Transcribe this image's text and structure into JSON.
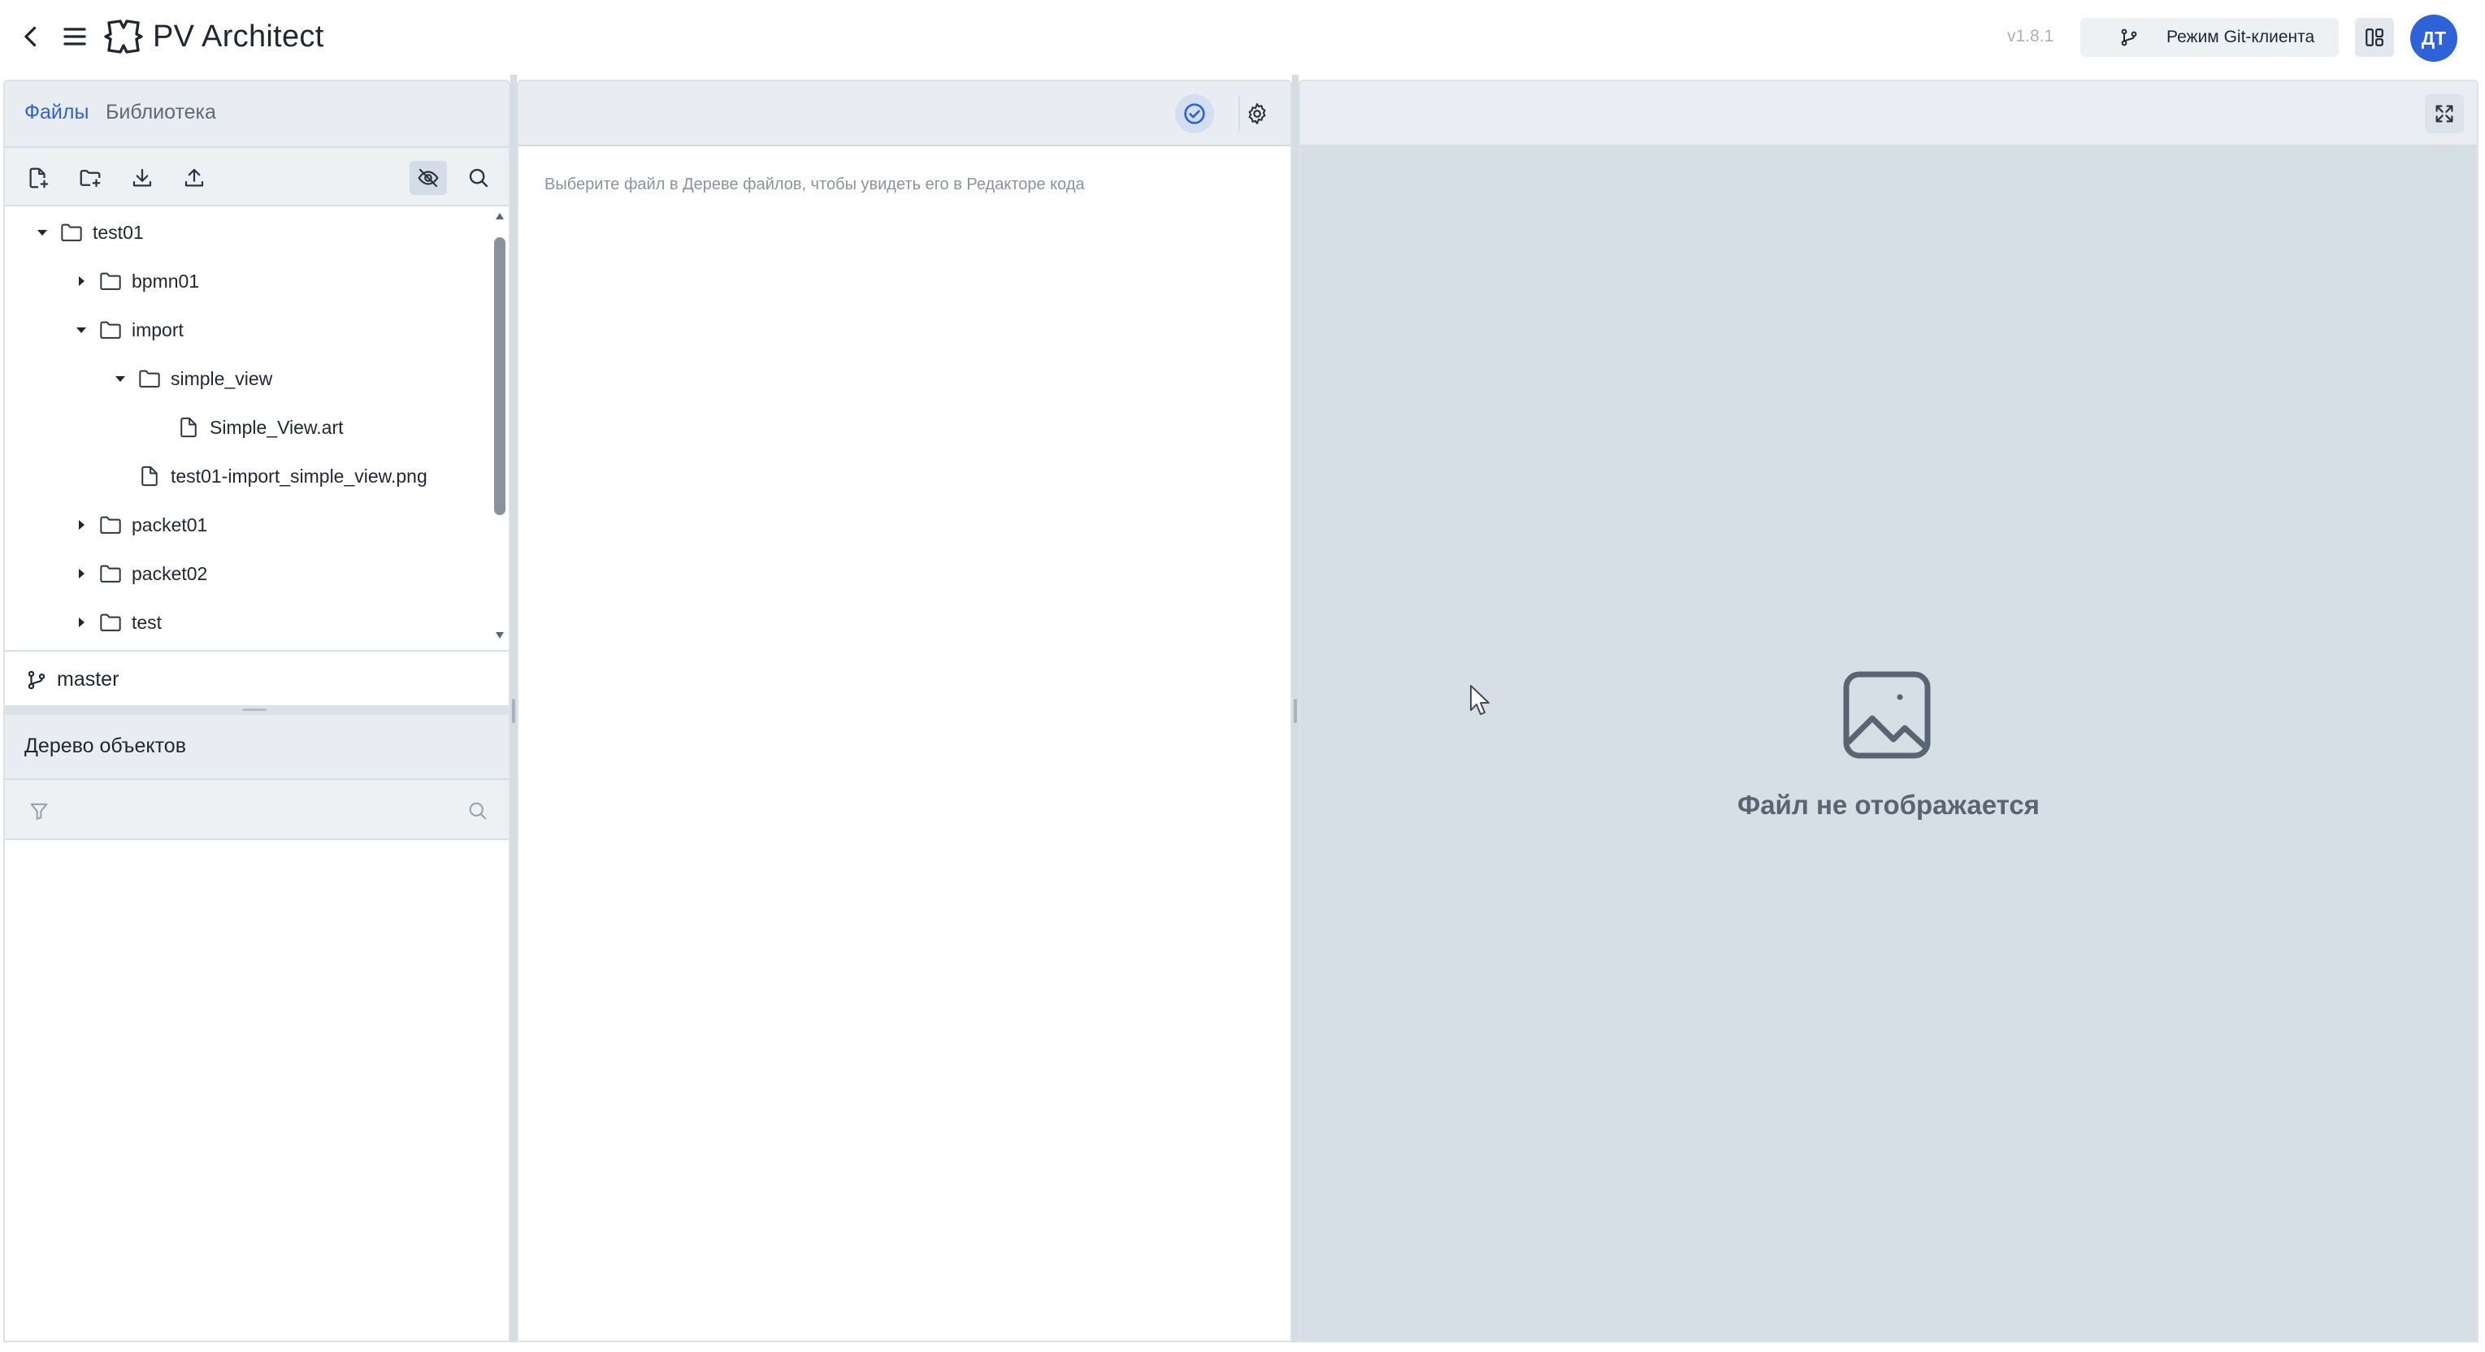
{
  "header": {
    "title": "PV Architect",
    "version": "v1.8.1",
    "git_mode_label": "Режим Git-клиента",
    "avatar_initials": "ДТ",
    "accent_color": "#2e62d9"
  },
  "left_panel": {
    "tabs": [
      {
        "label": "Файлы",
        "active": true
      },
      {
        "label": "Библиотека",
        "active": false
      }
    ],
    "toolbar_icons": [
      "new-file-icon",
      "new-folder-icon",
      "download-icon",
      "upload-icon",
      "eye-off-icon",
      "search-icon"
    ],
    "tree": [
      {
        "label": "test01",
        "type": "folder",
        "expanded": true,
        "depth": 0
      },
      {
        "label": "bpmn01",
        "type": "folder",
        "expanded": false,
        "depth": 1
      },
      {
        "label": "import",
        "type": "folder",
        "expanded": true,
        "depth": 1
      },
      {
        "label": "simple_view",
        "type": "folder",
        "expanded": true,
        "depth": 2
      },
      {
        "label": "Simple_View.art",
        "type": "file",
        "depth": 3
      },
      {
        "label": "test01-import_simple_view.png",
        "type": "file",
        "depth": 2
      },
      {
        "label": "packet01",
        "type": "folder",
        "expanded": false,
        "depth": 1
      },
      {
        "label": "packet02",
        "type": "folder",
        "expanded": false,
        "depth": 1
      },
      {
        "label": "test",
        "type": "folder",
        "expanded": false,
        "depth": 1
      }
    ],
    "branch": "master"
  },
  "object_tree": {
    "title": "Дерево объектов",
    "filter_value": ""
  },
  "editor": {
    "placeholder": "Выберите файл в Дереве файлов, чтобы увидеть его в Редакторе кода"
  },
  "preview": {
    "message": "Файл не отображается"
  }
}
